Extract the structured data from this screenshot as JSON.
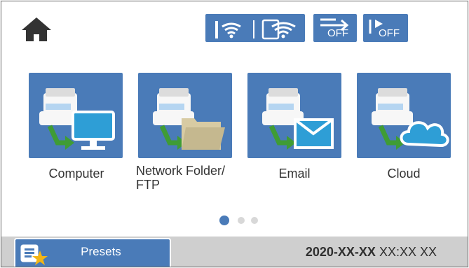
{
  "topbar": {
    "icons": [
      "home-icon",
      "wifi-signal-icon",
      "wifi-direct-icon",
      "data-transfer-off-icon",
      "quiet-mode-off-icon"
    ],
    "status_text_1": "OFF",
    "status_text_2": "OFF"
  },
  "tiles": [
    {
      "label": "Computer",
      "icon": "computer-icon"
    },
    {
      "label": "Network Folder/ FTP",
      "icon": "folder-icon"
    },
    {
      "label": "Email",
      "icon": "email-icon"
    },
    {
      "label": "Cloud",
      "icon": "cloud-icon"
    }
  ],
  "pagination": {
    "current_page": 1,
    "total_pages": 3
  },
  "bottombar": {
    "presets_label": "Presets",
    "date_text": "2020-XX-XX",
    "time_text": "XX:XX XX"
  },
  "colors": {
    "accent": "#4a7bb8",
    "dot_active": "#4a7bb8",
    "dot_inactive": "#d8d8d8"
  }
}
